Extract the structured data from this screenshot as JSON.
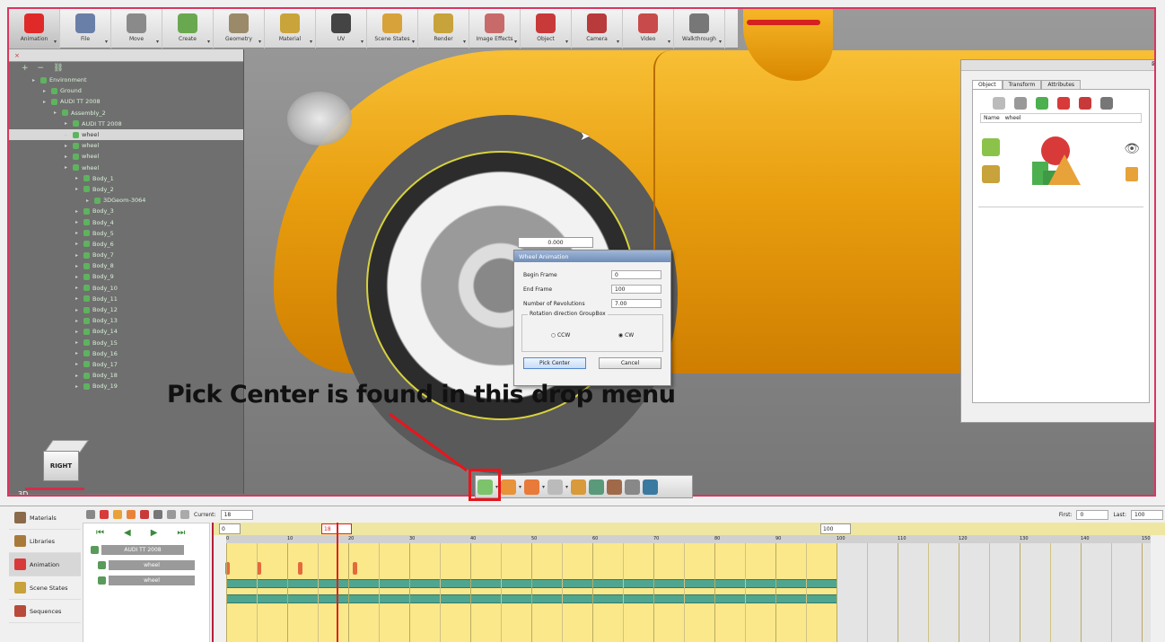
{
  "toolbar": {
    "items": [
      {
        "label": "Animation",
        "icon": "animation-icon",
        "color": "#e02a2a"
      },
      {
        "label": "File",
        "icon": "file-icon",
        "color": "#6a7fa8"
      },
      {
        "label": "Move",
        "icon": "move-icon",
        "color": "#8a8a8a"
      },
      {
        "label": "Create",
        "icon": "create-icon",
        "color": "#6aa84f"
      },
      {
        "label": "Geometry",
        "icon": "geometry-icon",
        "color": "#9a8a6a"
      },
      {
        "label": "Material",
        "icon": "material-icon",
        "color": "#c8a43a"
      },
      {
        "label": "UV",
        "icon": "uv-icon",
        "color": "#444444"
      },
      {
        "label": "Scene States",
        "icon": "scene-states-icon",
        "color": "#d8a23a"
      },
      {
        "label": "Render",
        "icon": "render-icon",
        "color": "#c8a23a"
      },
      {
        "label": "Image Effects",
        "icon": "image-effects-icon",
        "color": "#c86a6a"
      },
      {
        "label": "Object",
        "icon": "object-icon",
        "color": "#c83a3a"
      },
      {
        "label": "Camera",
        "icon": "camera-icon",
        "color": "#b83a3a"
      },
      {
        "label": "Video",
        "icon": "video-icon",
        "color": "#c84a4a"
      },
      {
        "label": "Walkthrough",
        "icon": "walkthrough-icon",
        "color": "#777777"
      }
    ]
  },
  "tree": {
    "header_close": "×",
    "rows": [
      {
        "label": "Environment",
        "indent": 1,
        "selected": false
      },
      {
        "label": "Ground",
        "indent": 2,
        "selected": false
      },
      {
        "label": "AUDI TT 2008",
        "indent": 2,
        "selected": false
      },
      {
        "label": "Assembly_2",
        "indent": 3,
        "selected": false
      },
      {
        "label": "AUDI TT 2008",
        "indent": 4,
        "selected": false
      },
      {
        "label": "wheel",
        "indent": 4,
        "selected": true
      },
      {
        "label": "wheel",
        "indent": 4,
        "selected": false
      },
      {
        "label": "wheel",
        "indent": 4,
        "selected": false
      },
      {
        "label": "wheel",
        "indent": 4,
        "selected": false
      },
      {
        "label": "Body_1",
        "indent": 5,
        "selected": false
      },
      {
        "label": "Body_2",
        "indent": 5,
        "selected": false
      },
      {
        "label": "3DGeom-3064",
        "indent": 6,
        "selected": false
      },
      {
        "label": "Body_3",
        "indent": 5,
        "selected": false
      },
      {
        "label": "Body_4",
        "indent": 5,
        "selected": false
      },
      {
        "label": "Body_5",
        "indent": 5,
        "selected": false
      },
      {
        "label": "Body_6",
        "indent": 5,
        "selected": false
      },
      {
        "label": "Body_7",
        "indent": 5,
        "selected": false
      },
      {
        "label": "Body_8",
        "indent": 5,
        "selected": false
      },
      {
        "label": "Body_9",
        "indent": 5,
        "selected": false
      },
      {
        "label": "Body_10",
        "indent": 5,
        "selected": false
      },
      {
        "label": "Body_11",
        "indent": 5,
        "selected": false
      },
      {
        "label": "Body_12",
        "indent": 5,
        "selected": false
      },
      {
        "label": "Body_13",
        "indent": 5,
        "selected": false
      },
      {
        "label": "Body_14",
        "indent": 5,
        "selected": false
      },
      {
        "label": "Body_15",
        "indent": 5,
        "selected": false
      },
      {
        "label": "Body_16",
        "indent": 5,
        "selected": false
      },
      {
        "label": "Body_17",
        "indent": 5,
        "selected": false
      },
      {
        "label": "Body_18",
        "indent": 5,
        "selected": false
      },
      {
        "label": "Body_19",
        "indent": 5,
        "selected": false
      }
    ]
  },
  "viewport": {
    "value_readout": "0.000",
    "cube_label": "RIGHT",
    "mode_label": "3D"
  },
  "dialog": {
    "title": "Wheel Animation",
    "fields": [
      {
        "label": "Begin Frame",
        "value": "0"
      },
      {
        "label": "End Frame",
        "value": "100"
      },
      {
        "label": "Number of Revolutions",
        "value": "7.00"
      }
    ],
    "group_label": "Rotation direction GroupBox",
    "radio_ccw": "CCW",
    "radio_cw": "CW",
    "selected_direction": "CW",
    "pick_center": "Pick Center",
    "cancel": "Cancel"
  },
  "annotation": "Pick Center is found in this drop menu",
  "properties": {
    "tabs": [
      "Object",
      "Transform",
      "Attributes"
    ],
    "active_tab": "Object",
    "name_label": "Name",
    "name_value": "wheel"
  },
  "bottom": {
    "nav": [
      {
        "label": "Materials",
        "active": false
      },
      {
        "label": "Libraries",
        "active": false
      },
      {
        "label": "Animation",
        "active": true
      },
      {
        "label": "Scene States",
        "active": false
      },
      {
        "label": "Sequences",
        "active": false
      }
    ],
    "current_label": "Current:",
    "current_value": "18",
    "first_label": "First:",
    "first_value": "0",
    "last_label": "Last:",
    "last_value": "100",
    "range_start": "0",
    "range_mid": "18",
    "range_end": "100",
    "tracks": [
      "AUDI TT 2008",
      "wheel",
      "wheel"
    ],
    "ticks": [
      "0",
      "10",
      "20",
      "30",
      "40",
      "50",
      "60",
      "70",
      "80",
      "90",
      "100",
      "110",
      "120",
      "130",
      "140",
      "150"
    ]
  }
}
